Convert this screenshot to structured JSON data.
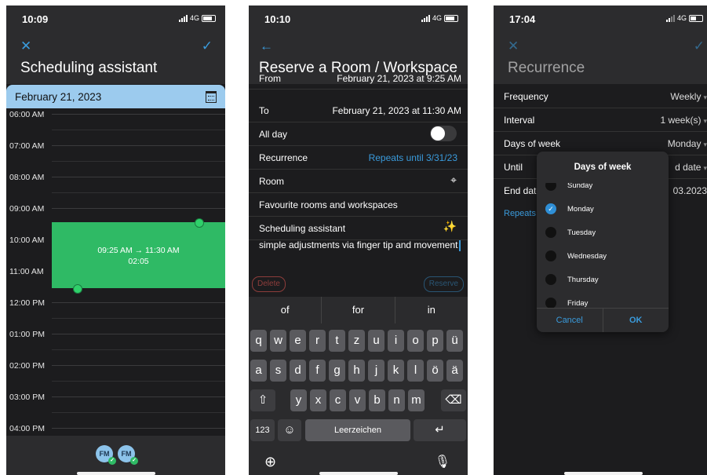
{
  "screen1": {
    "status": {
      "time": "10:09",
      "network": "4G"
    },
    "header": {
      "title": "Scheduling assistant"
    },
    "date": "February 21, 2023",
    "hours": [
      "06:00 AM",
      "07:00 AM",
      "08:00 AM",
      "09:00 AM",
      "10:00 AM",
      "11:00 AM",
      "12:00 PM",
      "01:00 PM",
      "02:00 PM",
      "03:00 PM",
      "04:00 PM"
    ],
    "event": {
      "range": "09:25 AM → 11:30 AM",
      "duration": "02:05"
    },
    "attendees": [
      "FM",
      "FM"
    ]
  },
  "screen2": {
    "status": {
      "time": "10:10",
      "network": "4G"
    },
    "header": {
      "title": "Reserve a Room / Workspace"
    },
    "rows": {
      "from_label": "From",
      "from_value": "February 21, 2023 at 9:25 AM",
      "to_label": "To",
      "to_value": "February 21, 2023 at 11:30 AM",
      "allday_label": "All day",
      "recurrence_label": "Recurrence",
      "recurrence_value": "Repeats until 3/31/23",
      "room_label": "Room",
      "favourites_label": "Favourite rooms and workspaces",
      "assistant_label": "Scheduling assistant"
    },
    "input_text": "simple adjustments via finger tip and movement",
    "delete_label": "Delete",
    "reserve_label": "Reserve",
    "keyboard": {
      "suggestions": [
        "of",
        "for",
        "in"
      ],
      "row1": [
        "q",
        "w",
        "e",
        "r",
        "t",
        "z",
        "u",
        "i",
        "o",
        "p",
        "ü"
      ],
      "row2": [
        "a",
        "s",
        "d",
        "f",
        "g",
        "h",
        "j",
        "k",
        "l",
        "ö",
        "ä"
      ],
      "row3": [
        "y",
        "x",
        "c",
        "v",
        "b",
        "n",
        "m"
      ],
      "numbers_label": "123",
      "space_label": "Leerzeichen"
    }
  },
  "screen3": {
    "status": {
      "time": "17:04",
      "network": "4G"
    },
    "header": {
      "title": "Recurrence"
    },
    "rows": {
      "frequency_label": "Frequency",
      "frequency_value": "Weekly",
      "interval_label": "Interval",
      "interval_value": "1 week(s)",
      "days_label": "Days of week",
      "days_value": "Monday",
      "until_label": "Until",
      "until_value": "d date",
      "enddate_label": "End date",
      "enddate_value": "03.2023",
      "repeats_label": "Repeats"
    },
    "dialog": {
      "title": "Days of week",
      "options": [
        "Sunday",
        "Monday",
        "Tuesday",
        "Wednesday",
        "Thursday",
        "Friday"
      ],
      "selected": "Monday",
      "cancel_label": "Cancel",
      "ok_label": "OK"
    }
  },
  "colors": {
    "accent": "#3a9bdc",
    "event_green": "#2fba65",
    "date_bar": "#9ccbee",
    "delete_red": "#d9534f"
  }
}
